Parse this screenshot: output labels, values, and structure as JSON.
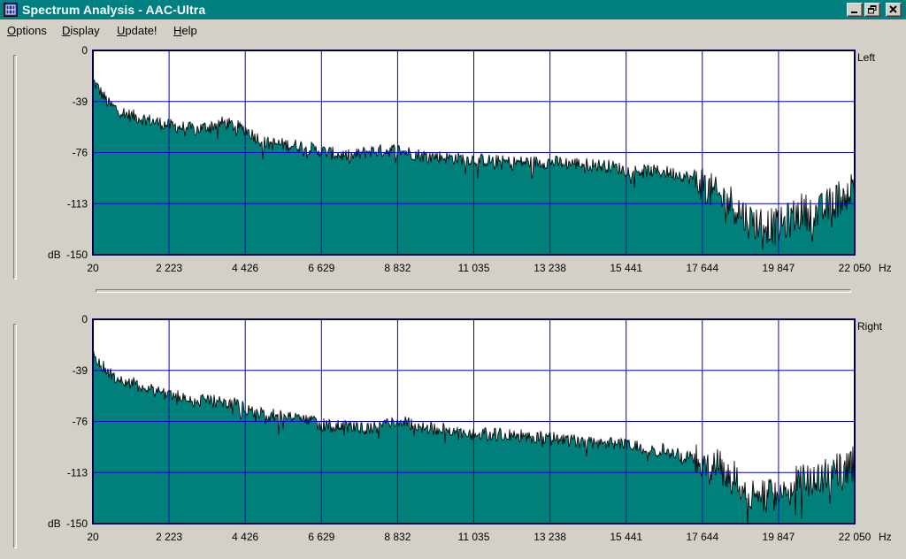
{
  "window": {
    "title": "Spectrum Analysis - AAC-Ultra",
    "app_icon": "spectrum-app-icon",
    "controls": [
      "minimize-icon",
      "restore-icon",
      "close-icon"
    ]
  },
  "menu": {
    "items": [
      {
        "label": "Options",
        "hotkey": "O"
      },
      {
        "label": "Display",
        "hotkey": "D"
      },
      {
        "label": "Update!",
        "hotkey": "U"
      },
      {
        "label": "Help",
        "hotkey": "H"
      }
    ]
  },
  "colors": {
    "window_bg": "#d4d0c8",
    "titlebar": "#008080",
    "spectrum_fill": "#007f7b",
    "grid": "#0000c8",
    "plot_bg": "#ffffff"
  },
  "chart_data": [
    {
      "type": "area",
      "channel_label": "Left",
      "unit_label": "Hz",
      "y_unit_label": "dB",
      "xlim": [
        20,
        22050
      ],
      "ylim": [
        -150,
        0
      ],
      "y_ticks": [
        "0",
        "-39",
        "-76",
        "-113",
        "-150"
      ],
      "x_ticks": [
        "20",
        "2 223",
        "4 426",
        "6 629",
        "8 832",
        "11 035",
        "13 238",
        "15 441",
        "17 644",
        "19 847",
        "22 050"
      ],
      "grid": true,
      "x": [
        20,
        500,
        1000,
        2223,
        3000,
        3800,
        4426,
        5000,
        6000,
        6629,
        7500,
        8000,
        8832,
        9500,
        10500,
        11035,
        12000,
        13238,
        14000,
        15000,
        15441,
        16500,
        17000,
        17644,
        18000,
        18500,
        19000,
        19847,
        20500,
        21000,
        21500,
        22050
      ],
      "values": [
        -22,
        -40,
        -47,
        -55,
        -58,
        -53,
        -58,
        -68,
        -70,
        -74,
        -78,
        -74,
        -73,
        -77,
        -79,
        -80,
        -82,
        -82,
        -83,
        -85,
        -88,
        -89,
        -91,
        -97,
        -106,
        -112,
        -125,
        -130,
        -118,
        -120,
        -110,
        -100
      ]
    },
    {
      "type": "area",
      "channel_label": "Right",
      "unit_label": "Hz",
      "y_unit_label": "dB",
      "xlim": [
        20,
        22050
      ],
      "ylim": [
        -150,
        0
      ],
      "y_ticks": [
        "0",
        "-39",
        "-76",
        "-113",
        "-150"
      ],
      "x_ticks": [
        "20",
        "2 223",
        "4 426",
        "6 629",
        "8 832",
        "11 035",
        "13 238",
        "15 441",
        "17 644",
        "19 847",
        "22 050"
      ],
      "grid": true,
      "x": [
        20,
        500,
        1000,
        2223,
        3000,
        3800,
        4426,
        5000,
        6000,
        6629,
        7500,
        8000,
        8832,
        9500,
        10500,
        11035,
        12000,
        13238,
        14000,
        15000,
        15441,
        16500,
        17000,
        17644,
        18000,
        18500,
        19000,
        19847,
        20500,
        21000,
        21500,
        22050
      ],
      "values": [
        -25,
        -40,
        -46,
        -55,
        -60,
        -60,
        -65,
        -70,
        -72,
        -77,
        -80,
        -80,
        -74,
        -79,
        -82,
        -84,
        -85,
        -87,
        -89,
        -90,
        -92,
        -96,
        -100,
        -103,
        -108,
        -115,
        -128,
        -132,
        -118,
        -120,
        -110,
        -105
      ]
    }
  ]
}
